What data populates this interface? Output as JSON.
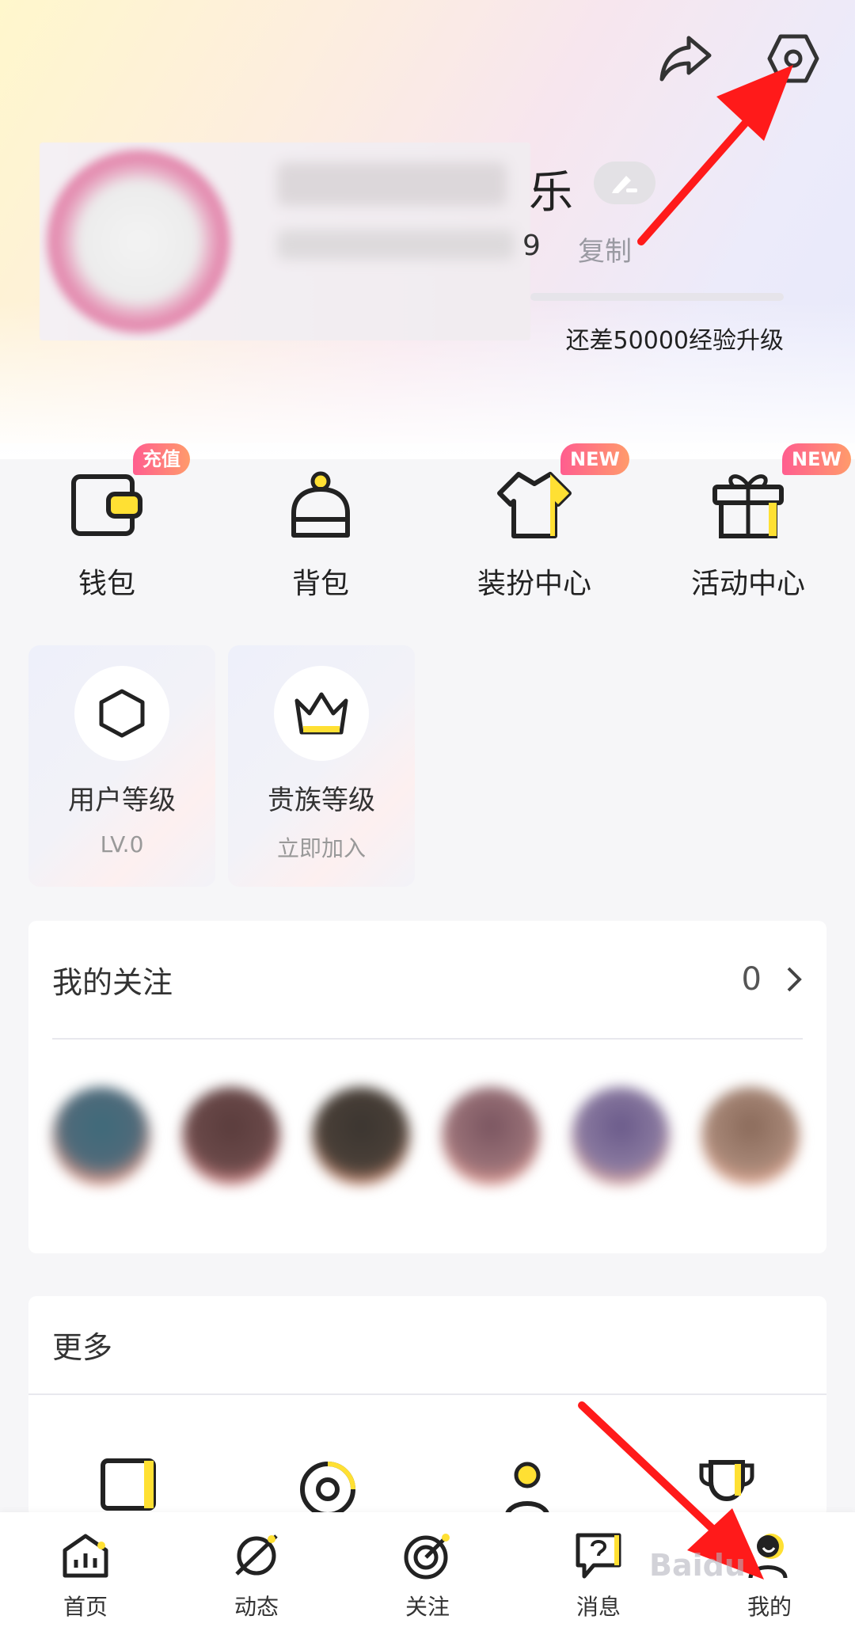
{
  "profile": {
    "name_visible_tail": "乐",
    "id_visible_tail": "9",
    "copy_label": "复制",
    "exp_text": "还差50000经验升级"
  },
  "shortcuts": [
    {
      "label": "钱包",
      "badge": "充值",
      "icon": "wallet-icon"
    },
    {
      "label": "背包",
      "badge": "",
      "icon": "backpack-icon"
    },
    {
      "label": "装扮中心",
      "badge": "NEW",
      "icon": "tshirt-icon"
    },
    {
      "label": "活动中心",
      "badge": "NEW",
      "icon": "gift-icon"
    }
  ],
  "levels": [
    {
      "title": "用户等级",
      "sub": "LV.0",
      "icon": "hexagon-icon"
    },
    {
      "title": "贵族等级",
      "sub": "立即加入",
      "icon": "crown-icon"
    }
  ],
  "follow": {
    "title": "我的关注",
    "count": "0"
  },
  "more": {
    "title": "更多"
  },
  "tabs": [
    {
      "label": "首页",
      "icon": "home-chart-icon"
    },
    {
      "label": "动态",
      "icon": "planet-icon"
    },
    {
      "label": "关注",
      "icon": "target-icon"
    },
    {
      "label": "消息",
      "icon": "message-icon"
    },
    {
      "label": "我的",
      "icon": "profile-icon"
    }
  ],
  "colors": {
    "accent_yellow": "#ffe033",
    "badge_gradient_start": "#ff5d8f",
    "badge_gradient_end": "#ff9b6b",
    "annotation_red": "#ff1a1a"
  }
}
